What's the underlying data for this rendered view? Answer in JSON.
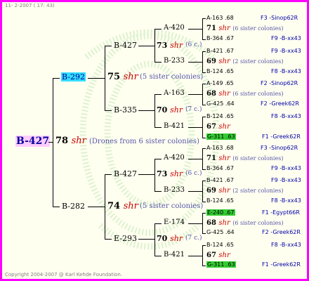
{
  "header": {
    "date": "11-  2-2007 ( 17: 43)"
  },
  "footer": {
    "copyright": "Copyright 2004-2007 @ Karl Kehde Foundation."
  },
  "root": {
    "id": "B-427",
    "sisters": "78",
    "shr": "shr",
    "note": "(Drones from 6 sister colonies)"
  },
  "upper": {
    "id": "B-292",
    "sisters": "75",
    "shr": "shr",
    "note": "(5 sister colonies)",
    "a": {
      "id": "B-427",
      "sisters": "73",
      "shr": "shr",
      "note": "(6 c.)",
      "a": {
        "id": "A-420",
        "sisters": "71",
        "shr": "shr",
        "note": "(6 sister colonies)",
        "a": {
          "id": "A-163",
          "val": ".68",
          "ctry": "F3 -Sinop62R"
        },
        "b": {
          "id": "B-364",
          "val": ".67",
          "ctry": "F9 -B-xx43"
        }
      },
      "b": {
        "id": "B-233",
        "sisters": "69",
        "shr": "shr",
        "note": "(2 sister colonies)",
        "a": {
          "id": "B-421",
          "val": ".67",
          "ctry": "F9 -B-xx43"
        },
        "b": {
          "id": "B-124",
          "val": ".65",
          "ctry": "F8 -B-xx43"
        }
      }
    },
    "b": {
      "id": "B-335",
      "sisters": "70",
      "shr": "shr",
      "note": "(7 c.)",
      "a": {
        "id": "A-163",
        "sisters": "68",
        "shr": "shr",
        "note": "(6 sister colonies)",
        "a": {
          "id": "A-149",
          "val": ".65",
          "ctry": "F2 -Sinop62R"
        },
        "b": {
          "id": "G-425",
          "val": ".64",
          "ctry": "F2 -Greek62R"
        }
      },
      "b": {
        "id": "B-421",
        "sisters": "67",
        "shr": "shr",
        "note": "",
        "a": {
          "id": "B-124",
          "val": ".65",
          "ctry": "F8 -B-xx43"
        },
        "b": {
          "id": "G-311",
          "val": ".63",
          "ctry": "F1 -Greek62R"
        }
      }
    }
  },
  "lower": {
    "id": "B-282",
    "sisters": "74",
    "shr": "shr",
    "note": "(5 sister colonies)",
    "a": {
      "id": "B-427",
      "sisters": "73",
      "shr": "shr",
      "note": "(6 c.)",
      "a": {
        "id": "A-420",
        "sisters": "71",
        "shr": "shr",
        "note": "(6 sister colonies)",
        "a": {
          "id": "A-163",
          "val": ".68",
          "ctry": "F3 -Sinop62R"
        },
        "b": {
          "id": "B-364",
          "val": ".67",
          "ctry": "F9 -B-xx43"
        }
      },
      "b": {
        "id": "B-233",
        "sisters": "69",
        "shr": "shr",
        "note": "(2 sister colonies)",
        "a": {
          "id": "B-421",
          "val": ".67",
          "ctry": "F9 -B-xx43"
        },
        "b": {
          "id": "B-124",
          "val": ".65",
          "ctry": "F8 -B-xx43"
        }
      }
    },
    "b": {
      "id": "E-293",
      "sisters": "70",
      "shr": "shr",
      "note": "(7 c.)",
      "a": {
        "id": "E-174",
        "sisters": "68",
        "shr": "shr",
        "note": "(6 sister colonies)",
        "a": {
          "id": "E-240",
          "val": ".67",
          "ctry": "F1 -Egypt66R"
        },
        "b": {
          "id": "G-425",
          "val": ".64",
          "ctry": "F2 -Greek62R"
        }
      },
      "b": {
        "id": "B-421",
        "sisters": "67",
        "shr": "shr",
        "note": "",
        "a": {
          "id": "B-124",
          "val": ".65",
          "ctry": "F8 -B-xx43"
        },
        "b": {
          "id": "G-311",
          "val": ".63",
          "ctry": "F1 -Greek62R"
        }
      }
    }
  }
}
